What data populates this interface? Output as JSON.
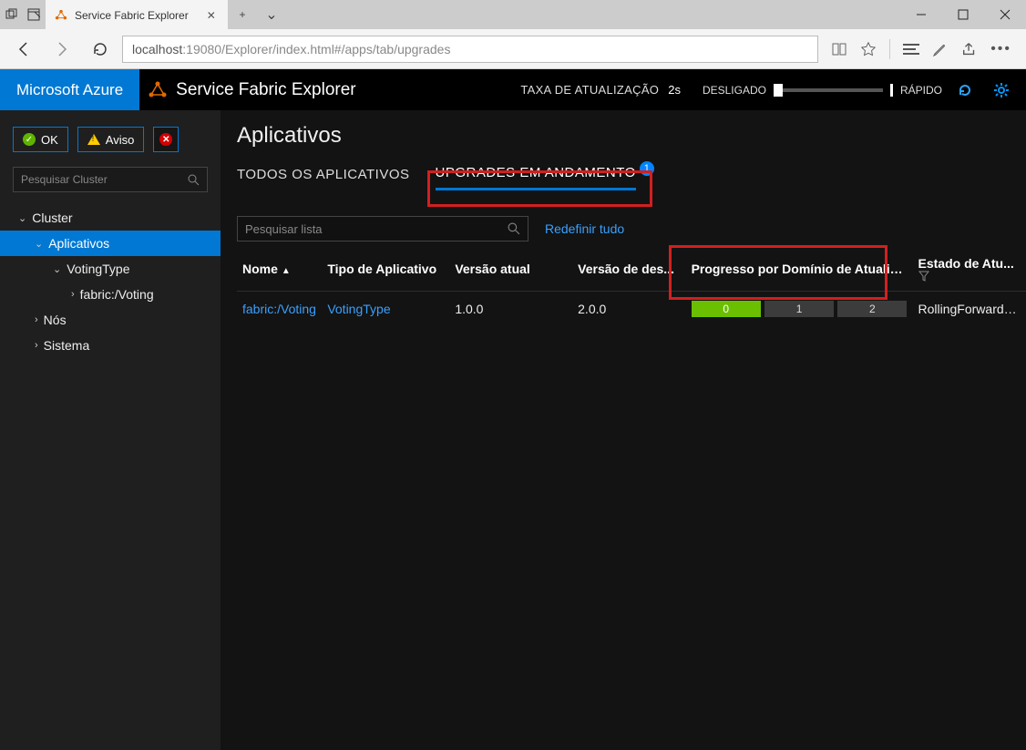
{
  "browser": {
    "tab_title": "Service Fabric Explorer",
    "url_proto": "localhost",
    "url_rest": ":19080/Explorer/index.html#/apps/tab/upgrades"
  },
  "header": {
    "azure": "Microsoft Azure",
    "title": "Service Fabric Explorer",
    "refresh_label": "TAXA DE ATUALIZAÇÃO",
    "refresh_value": "2s",
    "slow_label": "DESLIGADO",
    "fast_label": "RÁPIDO"
  },
  "sidebar": {
    "ok_label": "OK",
    "warn_label": "Aviso",
    "search_placeholder": "Pesquisar Cluster",
    "tree": {
      "cluster": "Cluster",
      "apps": "Aplicativos",
      "votingtype": "VotingType",
      "voting": "fabric:/Voting",
      "nodes": "Nós",
      "system": "Sistema"
    }
  },
  "main": {
    "title": "Aplicativos",
    "tabs": {
      "all": "TODOS OS APLICATIVOS",
      "upgrades": "UPGRADES EM ANDAMENTO",
      "upgrades_count": "1"
    },
    "list_search_placeholder": "Pesquisar lista",
    "reset": "Redefinir tudo",
    "columns": {
      "name": "Nome",
      "apptype": "Tipo de Aplicativo",
      "current": "Versão atual",
      "target": "Versão de des...",
      "progress": "Progresso por Domínio de Atualização",
      "state": "Estado de Atu..."
    },
    "row": {
      "name": "fabric:/Voting",
      "apptype": "VotingType",
      "current": "1.0.0",
      "target": "2.0.0",
      "ud0": "0",
      "ud1": "1",
      "ud2": "2",
      "state": "RollingForwardPe..."
    }
  }
}
